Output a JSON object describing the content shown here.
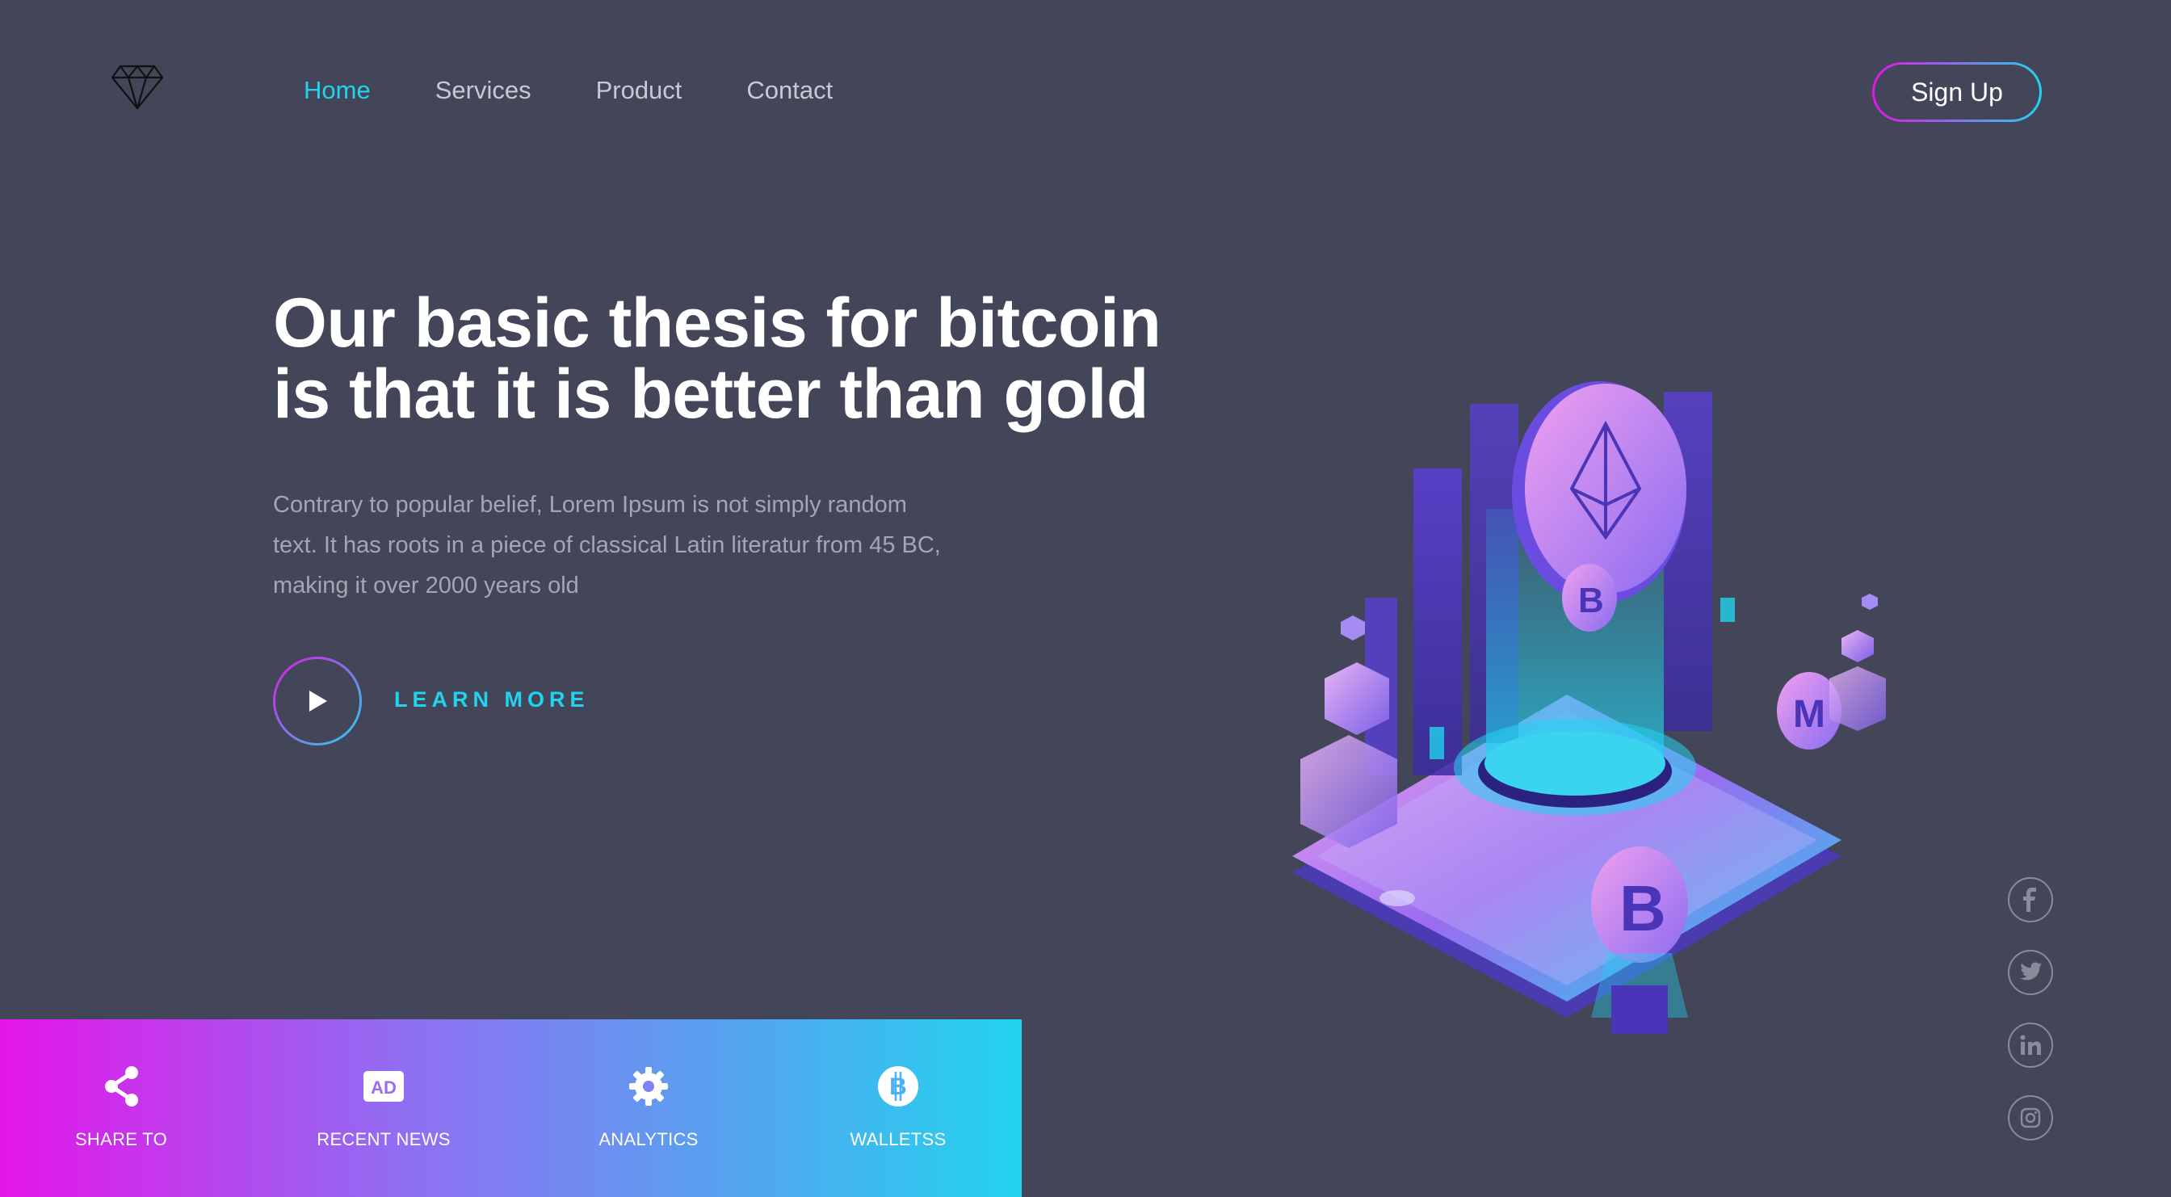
{
  "nav": {
    "items": [
      {
        "label": "Home",
        "active": true
      },
      {
        "label": "Services",
        "active": false
      },
      {
        "label": "Product",
        "active": false
      },
      {
        "label": "Contact",
        "active": false
      }
    ],
    "signup_label": "Sign Up"
  },
  "hero": {
    "headline_line1": "Our basic thesis for bitcoin",
    "headline_line2": "is that it is better than gold",
    "paragraph_line1": "Contrary to popular belief, Lorem Ipsum is not simply random",
    "paragraph_line2": "text. It has roots in a piece of classical Latin literatur from 45 BC,",
    "paragraph_line3": "making it over 2000 years old",
    "cta_label": "LEARN MORE"
  },
  "features": [
    {
      "label": "SHARE TO",
      "icon": "share-icon"
    },
    {
      "label": "RECENT NEWS",
      "icon": "ad-icon"
    },
    {
      "label": "ANALYTICS",
      "icon": "gear-icon"
    },
    {
      "label": "WALLETSS",
      "icon": "bitcoin-icon"
    }
  ],
  "social": [
    "facebook-icon",
    "twitter-icon",
    "linkedin-icon",
    "instagram-icon"
  ],
  "colors": {
    "background": "#434558",
    "accent": "#22d3ee",
    "gradient_start": "#e316e8",
    "gradient_end": "#22d3ee"
  }
}
